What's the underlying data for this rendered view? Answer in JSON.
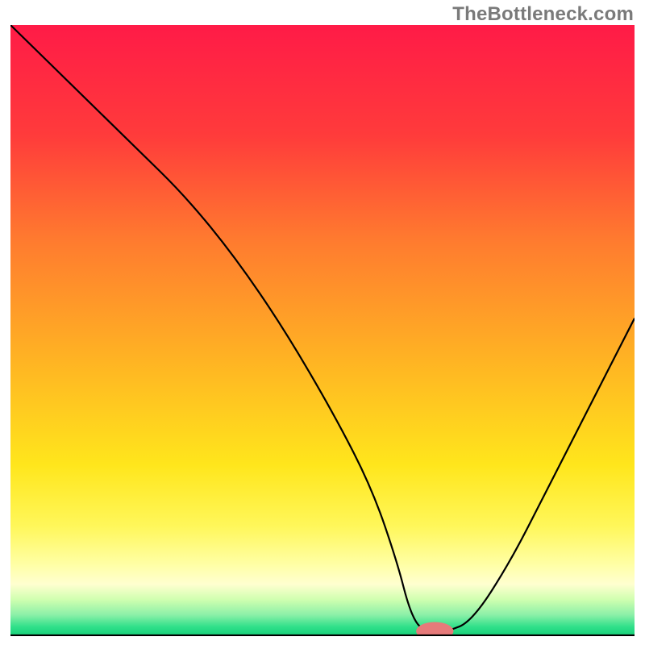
{
  "watermark": "TheBottleneck.com",
  "chart_data": {
    "type": "line",
    "title": "",
    "xlabel": "",
    "ylabel": "",
    "xlim": [
      0,
      100
    ],
    "ylim": [
      0,
      100
    ],
    "grid": false,
    "legend": false,
    "background_gradient": {
      "stops": [
        {
          "offset": 0.0,
          "color": "#ff1b47"
        },
        {
          "offset": 0.18,
          "color": "#ff3b3b"
        },
        {
          "offset": 0.35,
          "color": "#ff7a2f"
        },
        {
          "offset": 0.55,
          "color": "#ffb423"
        },
        {
          "offset": 0.72,
          "color": "#ffe61c"
        },
        {
          "offset": 0.82,
          "color": "#fff75a"
        },
        {
          "offset": 0.885,
          "color": "#ffffa8"
        },
        {
          "offset": 0.915,
          "color": "#ffffd0"
        },
        {
          "offset": 0.94,
          "color": "#d0ffb0"
        },
        {
          "offset": 0.965,
          "color": "#8cf0a8"
        },
        {
          "offset": 0.985,
          "color": "#2fe08a"
        },
        {
          "offset": 1.0,
          "color": "#17d078"
        }
      ]
    },
    "series": [
      {
        "name": "bottleneck-curve",
        "color": "#000000",
        "x": [
          0,
          10,
          20,
          28,
          36,
          44,
          52,
          58,
          62,
          64,
          66,
          70,
          74,
          80,
          86,
          92,
          100
        ],
        "y": [
          100,
          90,
          80,
          72,
          62,
          50,
          36,
          24,
          12,
          4,
          0.7,
          0.7,
          2.5,
          12,
          24,
          36,
          52
        ]
      }
    ],
    "marker": {
      "name": "target-marker",
      "color": "#e67a7a",
      "x": 68,
      "y": 0.8,
      "rx": 3.0,
      "ry": 1.5
    },
    "note": "values are approximate percentages read from the unlabeled axes"
  }
}
